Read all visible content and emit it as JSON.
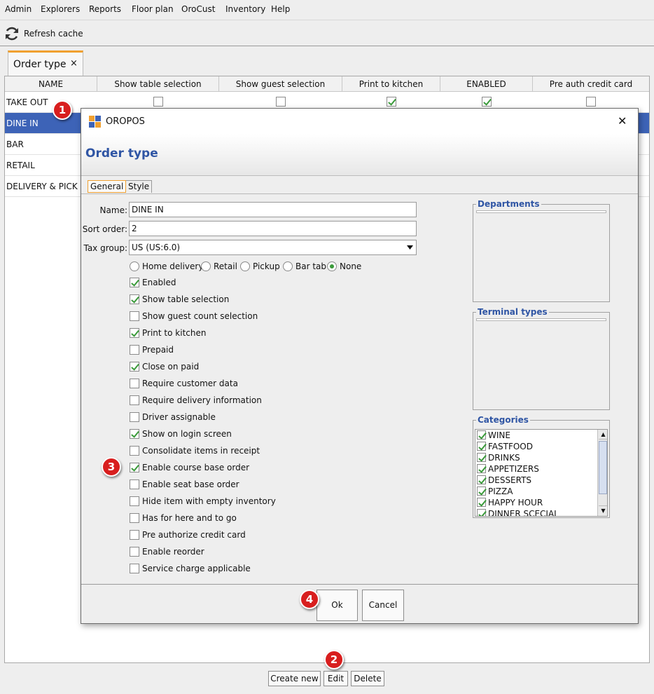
{
  "menu": [
    "Admin",
    "Explorers",
    "Reports",
    "Floor plan",
    "OroCust",
    "Inventory",
    "Help"
  ],
  "toolbar": {
    "refresh_label": "Refresh cache",
    "refresh_icon": "refresh-icon"
  },
  "doc_tab": {
    "label": "Order type",
    "close": "×"
  },
  "table": {
    "columns": [
      "NAME",
      "Show table selection",
      "Show guest selection",
      "Print to kitchen",
      "ENABLED",
      "Pre auth credit card"
    ],
    "rows": [
      {
        "name": "TAKE OUT",
        "show_table": false,
        "show_guest": false,
        "print_kitchen": true,
        "enabled": true,
        "pre_auth": false
      },
      {
        "name": "DINE IN"
      },
      {
        "name": "BAR"
      },
      {
        "name": "RETAIL"
      },
      {
        "name": "DELIVERY & PICK UP"
      }
    ],
    "selected_row": "DINE IN"
  },
  "bottom_buttons": {
    "create": "Create new",
    "edit": "Edit",
    "delete": "Delete"
  },
  "dialog": {
    "app_title": "OROPOS",
    "close": "✕",
    "header": "Order type",
    "tabs": [
      "General",
      "Style"
    ],
    "active_tab": "General",
    "fields": {
      "name_label": "Name:",
      "name_value": "DINE IN",
      "sort_label": "Sort order:",
      "sort_value": "2",
      "tax_label": "Tax group:",
      "tax_value": "US (US:6.0)"
    },
    "radio_options": [
      {
        "label": "Home delivery",
        "checked": false
      },
      {
        "label": "Retail",
        "checked": false
      },
      {
        "label": "Pickup",
        "checked": false
      },
      {
        "label": "Bar tab",
        "checked": false
      },
      {
        "label": "None",
        "checked": true
      }
    ],
    "checkboxes": [
      {
        "label": "Enabled",
        "checked": true
      },
      {
        "label": "Show table selection",
        "checked": true
      },
      {
        "label": "Show guest count selection",
        "checked": false
      },
      {
        "label": "Print to kitchen",
        "checked": true
      },
      {
        "label": "Prepaid",
        "checked": false
      },
      {
        "label": "Close on paid",
        "checked": true
      },
      {
        "label": "Require customer data",
        "checked": false
      },
      {
        "label": "Require delivery information",
        "checked": false
      },
      {
        "label": "Driver assignable",
        "checked": false
      },
      {
        "label": "Show on login screen",
        "checked": true
      },
      {
        "label": "Consolidate items in receipt",
        "checked": false
      },
      {
        "label": "Enable course base order",
        "checked": true
      },
      {
        "label": "Enable seat base order",
        "checked": false
      },
      {
        "label": "Hide item with empty inventory",
        "checked": false
      },
      {
        "label": "Has for here and to go",
        "checked": false
      },
      {
        "label": "Pre authorize credit card",
        "checked": false
      },
      {
        "label": "Enable reorder",
        "checked": false
      },
      {
        "label": "Service charge applicable",
        "checked": false
      }
    ],
    "groups": {
      "departments": "Departments",
      "terminal_types": "Terminal types",
      "categories": "Categories"
    },
    "categories": [
      {
        "label": "WINE",
        "checked": true
      },
      {
        "label": "FASTFOOD",
        "checked": true
      },
      {
        "label": "DRINKS",
        "checked": true
      },
      {
        "label": "APPETIZERS",
        "checked": true
      },
      {
        "label": "DESSERTS",
        "checked": true
      },
      {
        "label": "PIZZA",
        "checked": true
      },
      {
        "label": "HAPPY HOUR",
        "checked": true
      },
      {
        "label": "DINNER SCECIAL",
        "checked": true
      }
    ],
    "ok_label": "Ok",
    "cancel_label": "Cancel"
  },
  "badges": [
    "1",
    "2",
    "3",
    "4"
  ],
  "colors": {
    "selection": "#3d63b7",
    "header_blue": "#2f55a4",
    "tab_accent": "#f0a030",
    "badge_red": "#d81e1e",
    "check_green": "#3a9a3a"
  }
}
